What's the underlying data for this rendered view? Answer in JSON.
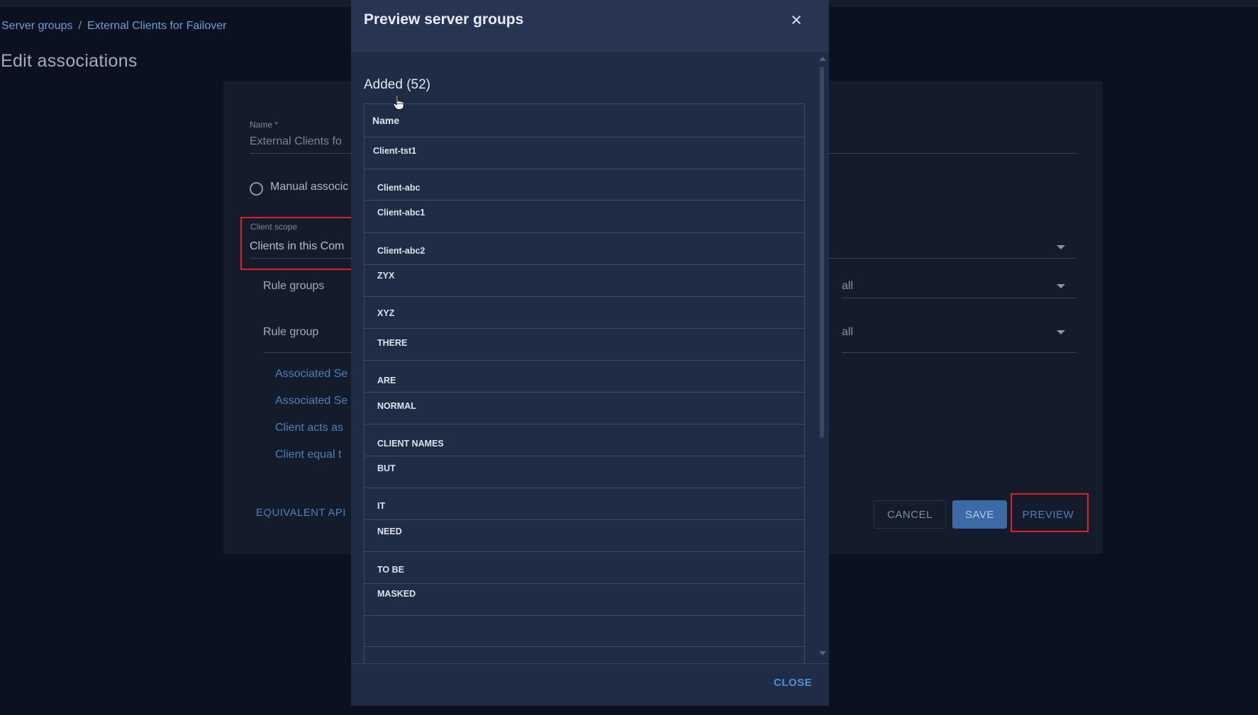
{
  "breadcrumb": {
    "item_1": "Server groups",
    "separator": "/",
    "item_2": "External Clients for Failover"
  },
  "page": {
    "title": "Edit associations"
  },
  "form": {
    "name_label": "Name *",
    "name_value": "External Clients fo",
    "radio_label": "Manual associc",
    "client_scope_label": "Client scope",
    "client_scope_value": "Clients in this Com",
    "rule_groups_label": "Rule groups",
    "rule_groups_value": "all",
    "rule_group_label": "Rule group",
    "rule_group_value": "all",
    "links": [
      "Associated Se",
      "Associated Se",
      "Client acts as",
      "Client equal t"
    ],
    "equivalent_api": "EQUIVALENT API"
  },
  "actions": {
    "cancel": "CANCEL",
    "save": "SAVE",
    "preview": "PREVIEW"
  },
  "modal": {
    "title": "Preview server groups",
    "close_icon": "close-icon",
    "section_title": "Added (52)",
    "column_header": "Name",
    "rows": [
      "Client-tst1",
      "Client-abc",
      "Client-abc1",
      "Client-abc2",
      "ZYX",
      "XYZ",
      "THERE",
      "ARE",
      "NORMAL",
      "CLIENT NAMES",
      "BUT",
      "IT",
      "NEED",
      "TO BE",
      "MASKED"
    ],
    "close_button": "CLOSE"
  },
  "colors": {
    "highlight_box": "#e02020",
    "accent": "#4f7fb8",
    "modal_bg": "#1f2c45"
  }
}
